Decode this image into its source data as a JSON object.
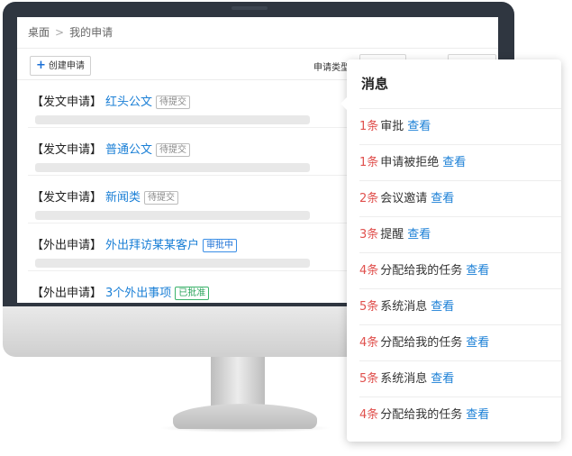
{
  "breadcrumb": {
    "home": "桌面",
    "separator": ">",
    "current": "我的申请"
  },
  "toolbar": {
    "create_label": "创建申请",
    "create_icon": "plus-icon",
    "filter_label": "申请类型"
  },
  "applications": [
    {
      "type": "【发文申请】",
      "title": "红头公文",
      "status": "待提交",
      "status_kind": "pending"
    },
    {
      "type": "【发文申请】",
      "title": "普通公文",
      "status": "待提交",
      "status_kind": "pending"
    },
    {
      "type": "【发文申请】",
      "title": "新闻类",
      "status": "待提交",
      "status_kind": "pending"
    },
    {
      "type": "【外出申请】",
      "title": "外出拜访某某客户",
      "status": "审批中",
      "status_kind": "reviewing"
    },
    {
      "type": "【外出申请】",
      "title": "3个外出事项",
      "status": "已批准",
      "status_kind": "approved"
    }
  ],
  "messages": {
    "title": "消息",
    "items": [
      {
        "count": "1条",
        "text": "审批",
        "link": "查看"
      },
      {
        "count": "1条",
        "text": "申请被拒绝",
        "link": "查看"
      },
      {
        "count": "2条",
        "text": "会议邀请",
        "link": "查看"
      },
      {
        "count": "3条",
        "text": "提醒",
        "link": "查看"
      },
      {
        "count": "4条",
        "text": "分配给我的任务",
        "link": "查看"
      },
      {
        "count": "5条",
        "text": "系统消息",
        "link": "查看"
      },
      {
        "count": "4条",
        "text": "分配给我的任务",
        "link": "查看"
      },
      {
        "count": "5条",
        "text": "系统消息",
        "link": "查看"
      },
      {
        "count": "4条",
        "text": "分配给我的任务",
        "link": "查看"
      }
    ]
  },
  "colors": {
    "accent": "#1a7fd6",
    "count": "#e0504d",
    "bezel": "#2f3640"
  }
}
